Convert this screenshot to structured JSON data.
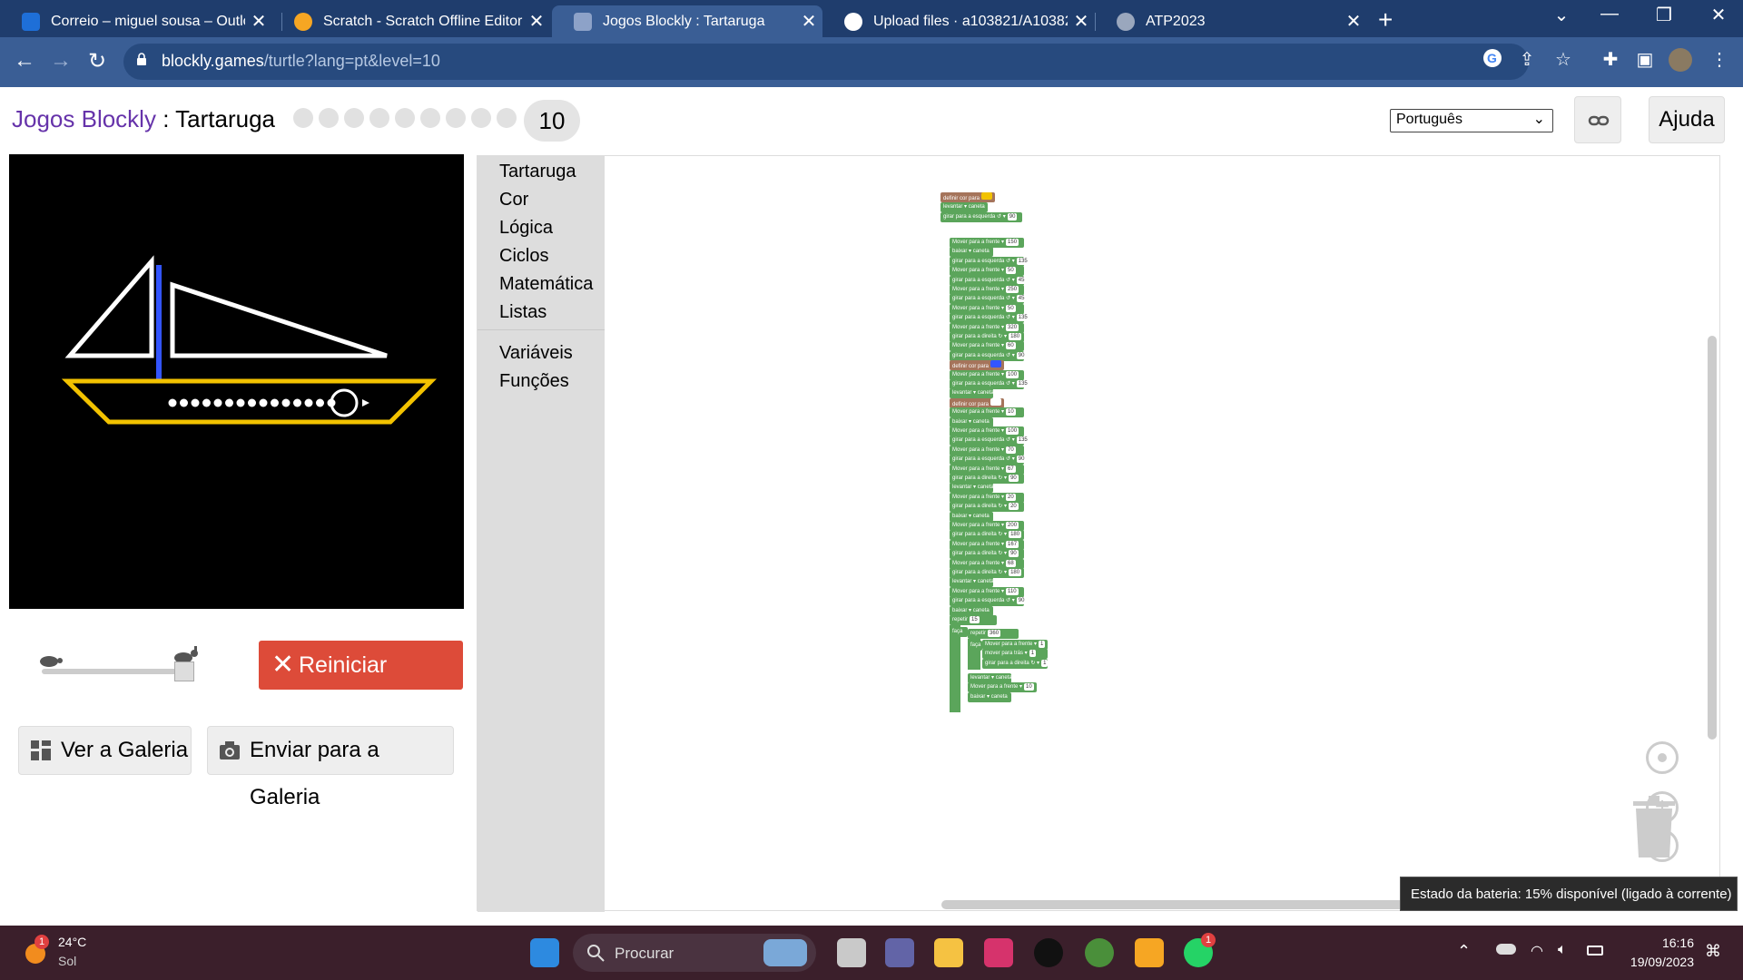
{
  "browser": {
    "tabs": [
      {
        "title": "Correio – miguel sousa – Outlook",
        "favicon_color": "#1e6fd8"
      },
      {
        "title": "Scratch - Scratch Offline Editor",
        "favicon_color": "#f6a623"
      },
      {
        "title": "Jogos Blockly : Tartaruga",
        "favicon_color": "#8da2c8",
        "active": true
      },
      {
        "title": "Upload files · a103821/A103821",
        "favicon_color": "#ffffff"
      },
      {
        "title": "ATP2023",
        "favicon_color": "#9aa7bd"
      }
    ],
    "url_host": "blockly.games",
    "url_path": "/turtle?lang=pt&level=10"
  },
  "header": {
    "app_name": "Jogos Blockly",
    "separator": " : ",
    "game_name": "Tartaruga",
    "current_level": "10",
    "completed_levels": 9,
    "language": "Português",
    "help_label": "Ajuda"
  },
  "controls": {
    "speed_slider_value": 1.0,
    "reset_label": "Reiniciar",
    "gallery_label": "Ver a Galeria",
    "submit_label": "Enviar para a Galeria"
  },
  "toolbox": {
    "categories": [
      "Tartaruga",
      "Cor",
      "Lógica",
      "Ciclos",
      "Matemática",
      "Listas"
    ],
    "categories2": [
      "Variáveis",
      "Funções"
    ]
  },
  "blocks": {
    "set_color": "definir cor para",
    "pen_up": "levantar",
    "pen_down": "baixar",
    "pen_word": "caneta",
    "turn": "girar para a",
    "left": "esquerda ↺",
    "right": "direita ↻",
    "move_fwd": "Mover para a frente",
    "move_back": "mover para trás",
    "repeat": "repetir",
    "times": "vez",
    "do": "faça",
    "top_turn_value": "90",
    "sequence": [
      [
        "move_fwd",
        "150"
      ],
      [
        "pen_down",
        ""
      ],
      [
        "turn_left",
        "135"
      ],
      [
        "move_fwd",
        "50"
      ],
      [
        "turn_left",
        "45"
      ],
      [
        "move_fwd",
        "250"
      ],
      [
        "turn_left",
        "45"
      ],
      [
        "move_fwd",
        "50"
      ],
      [
        "turn_left",
        "135"
      ],
      [
        "move_fwd",
        "320"
      ],
      [
        "turn_right",
        "180"
      ],
      [
        "move_fwd",
        "60"
      ],
      [
        "turn_left",
        "90"
      ],
      [
        "set_color_blue",
        ""
      ],
      [
        "move_fwd",
        "100"
      ],
      [
        "turn_left",
        "135"
      ],
      [
        "pen_up",
        ""
      ],
      [
        "set_color_white",
        ""
      ],
      [
        "move_fwd",
        "10"
      ],
      [
        "pen_down",
        ""
      ],
      [
        "move_fwd",
        "100"
      ],
      [
        "turn_left",
        "135"
      ],
      [
        "move_fwd",
        "70"
      ],
      [
        "turn_left",
        "90"
      ],
      [
        "move_fwd",
        "67"
      ],
      [
        "turn_right",
        "90"
      ],
      [
        "pen_up",
        ""
      ],
      [
        "move_fwd",
        "20"
      ],
      [
        "turn_right",
        "20"
      ],
      [
        "pen_down",
        ""
      ],
      [
        "move_fwd",
        "200"
      ],
      [
        "turn_right",
        "180"
      ],
      [
        "move_fwd",
        "167"
      ],
      [
        "turn_right",
        "90"
      ],
      [
        "move_fwd",
        "68"
      ],
      [
        "turn_right",
        "180"
      ],
      [
        "pen_up",
        ""
      ],
      [
        "move_fwd",
        "110"
      ],
      [
        "turn_left",
        "90"
      ],
      [
        "pen_down",
        ""
      ]
    ],
    "outer_repeat": "15",
    "inner_repeat": "360",
    "inner_body": [
      [
        "move_fwd",
        "1"
      ],
      [
        "move_back",
        "1"
      ],
      [
        "turn_right",
        "1"
      ]
    ],
    "after_inner": [
      [
        "pen_up",
        ""
      ],
      [
        "move_fwd",
        "10"
      ],
      [
        "pen_down",
        ""
      ]
    ]
  },
  "tooltip": "Estado da bateria: 15% disponível (ligado à corrente)",
  "taskbar": {
    "temperature": "24°C",
    "condition": "Sol",
    "search_placeholder": "Procurar",
    "time": "16:16",
    "date": "19/09/2023",
    "weather_badge": "1",
    "whatsapp_badge": "1"
  }
}
